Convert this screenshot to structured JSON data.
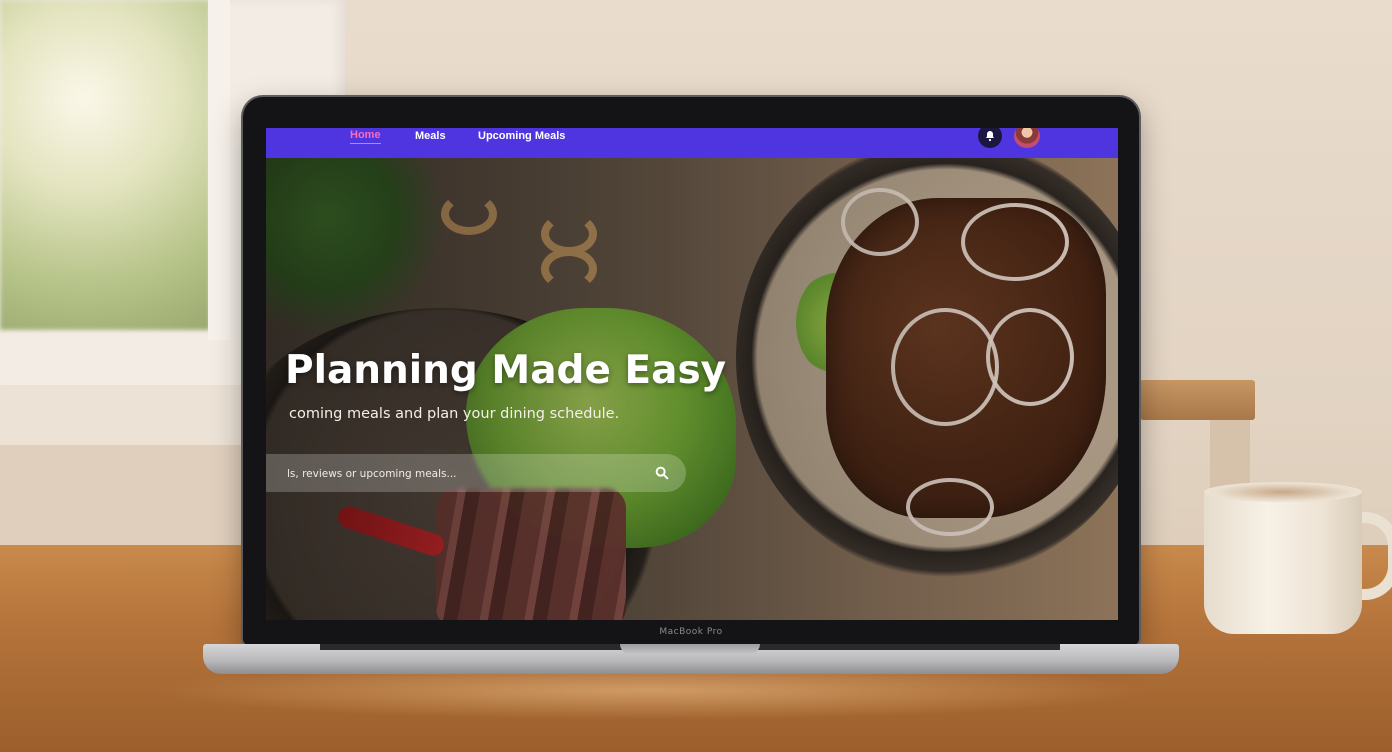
{
  "nav": {
    "home_label": "Home",
    "meals_label": "Meals",
    "upcoming_label": "Upcoming Meals",
    "active_color": "#ff6bb5",
    "bar_color": "#4f35e0"
  },
  "hero": {
    "title": "Planning Made Easy",
    "subtitle": "coming meals and plan your dining schedule."
  },
  "search": {
    "placeholder": "ls, reviews or upcoming meals...",
    "icon": "search-icon"
  },
  "laptop": {
    "bezel_label": "MacBook Pro"
  },
  "icons": {
    "notifications": "bell-icon",
    "profile": "avatar"
  }
}
